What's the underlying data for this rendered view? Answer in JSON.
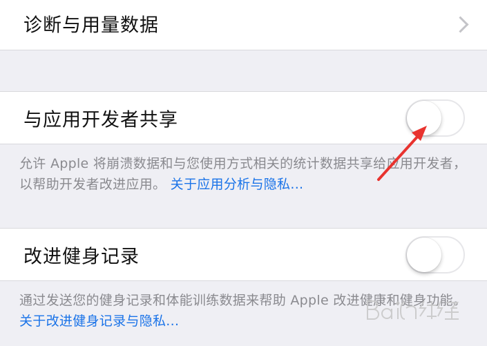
{
  "rows": {
    "diagnostics": {
      "label": "诊断与用量数据"
    },
    "share_with_developers": {
      "label": "与应用开发者共享",
      "toggle_on": false,
      "footer_text": "允许 Apple 将崩溃数据和与您使用方式相关的统计数据共享给应用开发者，以帮助开发者改进应用。",
      "footer_link": "关于应用分析与隐私..."
    },
    "improve_activity": {
      "label": "改进健身记录",
      "toggle_on": false,
      "footer_text": "通过发送您的健身记录和体能训练数据来帮助 Apple 改进健康和健身功能。",
      "footer_link": "关于改进健身记录与隐私..."
    }
  },
  "annotation": {
    "arrow_color": "#e8332f"
  },
  "watermark": {
    "text": "Bai du 经验",
    "color": "#c9c9c9"
  },
  "colors": {
    "background": "#efeff4",
    "cell": "#ffffff",
    "label": "#111111",
    "footer": "#8a8a8f",
    "link": "#1a73e8"
  }
}
